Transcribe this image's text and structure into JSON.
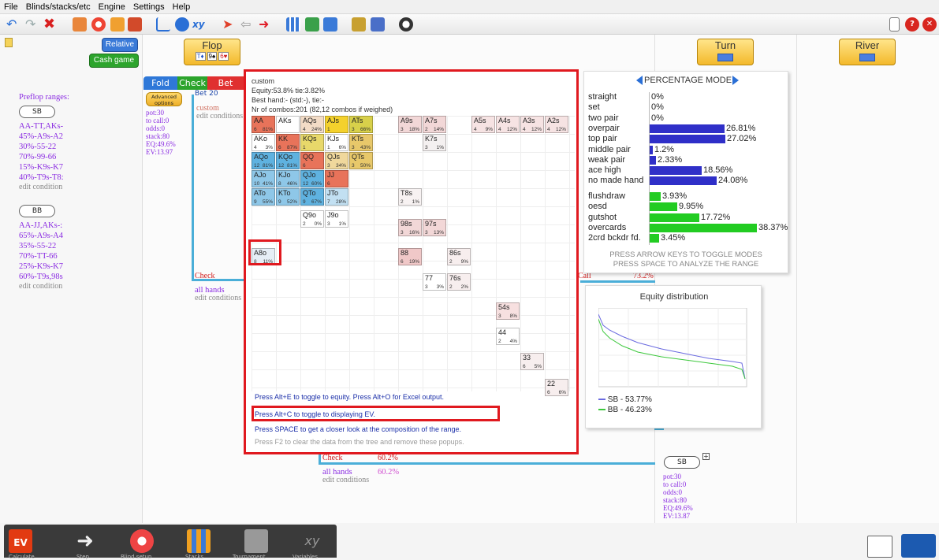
{
  "menu": [
    "File",
    "Blinds/stacks/etc",
    "Engine",
    "Settings",
    "Help"
  ],
  "toolbar_icons": [
    "undo-icon",
    "redo-icon",
    "delete-icon",
    "hand-icon",
    "lifebuoy-icon",
    "chips-icon",
    "cards-icon",
    "chart-icon",
    "refresh-icon",
    "xy-icon",
    "arrow-right-icon",
    "arrow-left-icon",
    "arrow-red-icon",
    "grid-icon",
    "calc-icon",
    "tree-icon",
    "db-icon",
    "scale-icon",
    "yinyang-icon"
  ],
  "left": {
    "relative_label": "Relative",
    "cash_label": "Cash game",
    "preflop_title": "Preflop ranges:",
    "sb": {
      "label": "SB",
      "lines": [
        "AA-TT,AKs-",
        "45%-A9s-A2",
        "30%-55-22",
        "70%-99-66",
        "15%-K9s-K7",
        "40%-T9s-T8:"
      ],
      "edit": "edit condition"
    },
    "bb": {
      "label": "BB",
      "lines": [
        "AA-JJ,AKs-:",
        "65%-A9s-A4",
        "35%-55-22",
        "70%-TT-66",
        "25%-K9s-K7",
        "60%-T9s,98s"
      ],
      "edit": "edit condition"
    }
  },
  "streets": {
    "flop": "Flop",
    "flop_cards": [
      "T♦",
      "9♠",
      "6♥"
    ],
    "turn": "Turn",
    "river": "River"
  },
  "actions": {
    "fold": "Fold",
    "check": "Check",
    "bet": "Bet",
    "advanced": "Advanced options",
    "bet20": "Bet 20"
  },
  "node_stats": [
    "pot:30",
    "to call:0",
    "odds:0",
    "stack:80",
    "EQ:49.6%",
    "EV:13.97"
  ],
  "tree": {
    "custom": "custom",
    "edit_conditions": "edit conditions",
    "check": "Check",
    "all_hands": "all hands",
    "call": "Call",
    "call_pct": "73.2%",
    "check2": "Check",
    "check2_pct": "60.2%",
    "all_hands2": "all hands",
    "all_hands2_pct": "60.2%",
    "edit2": "edit conditions",
    "sb_label": "SB",
    "sb_stats": [
      "pot:30",
      "to call:0",
      "odds:0",
      "stack:80",
      "EQ:49.6%",
      "EV:13.87"
    ]
  },
  "popup": {
    "header": [
      "custom",
      "Equity:53.8% tie:3.82%",
      "Best hand:- (std:-), tie:-",
      "Nr of combos:201   (82,12 combos if weighed)"
    ],
    "cells": [
      {
        "n": "AA",
        "c": "6",
        "p": "81%",
        "bg": "#e8735a"
      },
      {
        "n": "AKs",
        "c": "",
        "p": "",
        "bg": "#ffffff"
      },
      {
        "n": "AQs",
        "c": "4",
        "p": "24%",
        "bg": "#f3dcc6"
      },
      {
        "n": "AJs",
        "c": "1",
        "p": "",
        "bg": "#f4d12c"
      },
      {
        "n": "ATs",
        "c": "3",
        "p": "66%",
        "bg": "#d8d04a"
      },
      {
        "n": "A9s",
        "c": "3",
        "p": "18%",
        "bg": "#f2d7d7"
      },
      {
        "n": "A7s",
        "c": "2",
        "p": "14%",
        "bg": "#f2d7d7"
      },
      {
        "n": "A5s",
        "c": "4",
        "p": "9%",
        "bg": "#f6e3e3"
      },
      {
        "n": "A4s",
        "c": "4",
        "p": "12%",
        "bg": "#f6e3e3"
      },
      {
        "n": "A3s",
        "c": "4",
        "p": "12%",
        "bg": "#f6e3e3"
      },
      {
        "n": "A2s",
        "c": "4",
        "p": "12%",
        "bg": "#f6e3e3"
      },
      {
        "n": "AKo",
        "c": "4",
        "p": "3%",
        "bg": "#ffffff"
      },
      {
        "n": "KK",
        "c": "6",
        "p": "87%",
        "bg": "#e8735a"
      },
      {
        "n": "KQs",
        "c": "1",
        "p": "",
        "bg": "#e8d86a"
      },
      {
        "n": "KJs",
        "c": "1",
        "p": "6%",
        "bg": "#ffffff"
      },
      {
        "n": "KTs",
        "c": "3",
        "p": "43%",
        "bg": "#e8c86a"
      },
      {
        "n": "K7s",
        "c": "3",
        "p": "1%",
        "bg": "#f4f0f0"
      },
      {
        "n": "AQo",
        "c": "12",
        "p": "81%",
        "bg": "#5fb2e0"
      },
      {
        "n": "KQo",
        "c": "12",
        "p": "81%",
        "bg": "#5fb2e0"
      },
      {
        "n": "QQ",
        "c": "6",
        "p": "",
        "bg": "#e8735a"
      },
      {
        "n": "QJs",
        "c": "3",
        "p": "34%",
        "bg": "#f0d89c"
      },
      {
        "n": "QTs",
        "c": "3",
        "p": "50%",
        "bg": "#e8c86a"
      },
      {
        "n": "AJo",
        "c": "10",
        "p": "41%",
        "bg": "#8ec7e8"
      },
      {
        "n": "KJo",
        "c": "8",
        "p": "46%",
        "bg": "#8ec7e8"
      },
      {
        "n": "QJo",
        "c": "12",
        "p": "60%",
        "bg": "#5fb2e0"
      },
      {
        "n": "JJ",
        "c": "6",
        "p": "",
        "bg": "#e8735a"
      },
      {
        "n": "ATo",
        "c": "9",
        "p": "55%",
        "bg": "#8ec7e8"
      },
      {
        "n": "KTo",
        "c": "9",
        "p": "52%",
        "bg": "#8ec7e8"
      },
      {
        "n": "QTo",
        "c": "9",
        "p": "67%",
        "bg": "#5fb2e0"
      },
      {
        "n": "JTo",
        "c": "7",
        "p": "28%",
        "bg": "#c2e0f2"
      },
      {
        "n": "T8s",
        "c": "2",
        "p": "1%",
        "bg": "#f7f2f2"
      },
      {
        "n": "Q9o",
        "c": "2",
        "p": "0%",
        "bg": "#ffffff"
      },
      {
        "n": "J9o",
        "c": "3",
        "p": "1%",
        "bg": "#ffffff"
      },
      {
        "n": "98s",
        "c": "3",
        "p": "16%",
        "bg": "#f2d7d7"
      },
      {
        "n": "97s",
        "c": "3",
        "p": "13%",
        "bg": "#f2d7d7"
      },
      {
        "n": "A8o",
        "c": "8",
        "p": "11%",
        "bg": "#e6eef6"
      },
      {
        "n": "88",
        "c": "6",
        "p": "19%",
        "bg": "#f0c8c8"
      },
      {
        "n": "86s",
        "c": "2",
        "p": "9%",
        "bg": "#f7eeee"
      },
      {
        "n": "77",
        "c": "3",
        "p": "3%",
        "bg": "#ffffff"
      },
      {
        "n": "76s",
        "c": "2",
        "p": "2%",
        "bg": "#f7eeee"
      },
      {
        "n": "54s",
        "c": "3",
        "p": "8%",
        "bg": "#f7e0e0"
      },
      {
        "n": "44",
        "c": "2",
        "p": "4%",
        "bg": "#ffffff"
      },
      {
        "n": "33",
        "c": "6",
        "p": "5%",
        "bg": "#f7eeee"
      },
      {
        "n": "22",
        "c": "6",
        "p": "6%",
        "bg": "#f7eeee"
      }
    ],
    "help": [
      "Press Alt+E to toggle to equity. Press Alt+O for Excel output.",
      "Press Alt+C to toggle to displaying EV.",
      "Press SPACE to get a closer look at the composition of the range."
    ],
    "help_grey": "Press F2 to clear the data from the tree and remove these popups."
  },
  "pct": {
    "title": "PERCENTAGE MODE",
    "rows1": [
      {
        "label": "straight",
        "value": "0%",
        "frac": 0
      },
      {
        "label": "set",
        "value": "0%",
        "frac": 0
      },
      {
        "label": "two pair",
        "value": "0%",
        "frac": 0
      },
      {
        "label": "overpair",
        "value": "26.81%",
        "frac": 0.2681
      },
      {
        "label": "top pair",
        "value": "27.02%",
        "frac": 0.2702
      },
      {
        "label": "middle pair",
        "value": "1.2%",
        "frac": 0.012
      },
      {
        "label": "weak pair",
        "value": "2.33%",
        "frac": 0.0233
      },
      {
        "label": "ace high",
        "value": "18.56%",
        "frac": 0.1856
      },
      {
        "label": "no made hand",
        "value": "24.08%",
        "frac": 0.2408
      }
    ],
    "rows2": [
      {
        "label": "flushdraw",
        "value": "3.93%",
        "frac": 0.0393
      },
      {
        "label": "oesd",
        "value": "9.95%",
        "frac": 0.0995
      },
      {
        "label": "gutshot",
        "value": "17.72%",
        "frac": 0.1772
      },
      {
        "label": "overcards",
        "value": "38.37%",
        "frac": 0.3837
      },
      {
        "label": "2crd bckdr fd.",
        "value": "3.45%",
        "frac": 0.0345
      }
    ],
    "note1": "PRESS ARROW KEYS TO TOGGLE MODES",
    "note2": "PRESS SPACE TO ANALYZE THE RANGE",
    "colors": {
      "made": "#2f2fc8",
      "draw": "#22cc22"
    }
  },
  "equity": {
    "title": "Equity distribution",
    "legend": [
      "SB - 53.77%",
      "BB - 46.23%"
    ],
    "colors": [
      "#6a6ae0",
      "#3cc83c"
    ]
  },
  "bottom": {
    "labels": [
      "Calculate",
      "Step",
      "Blind setup",
      "Stacks",
      "Tournament",
      "Variables"
    ]
  }
}
